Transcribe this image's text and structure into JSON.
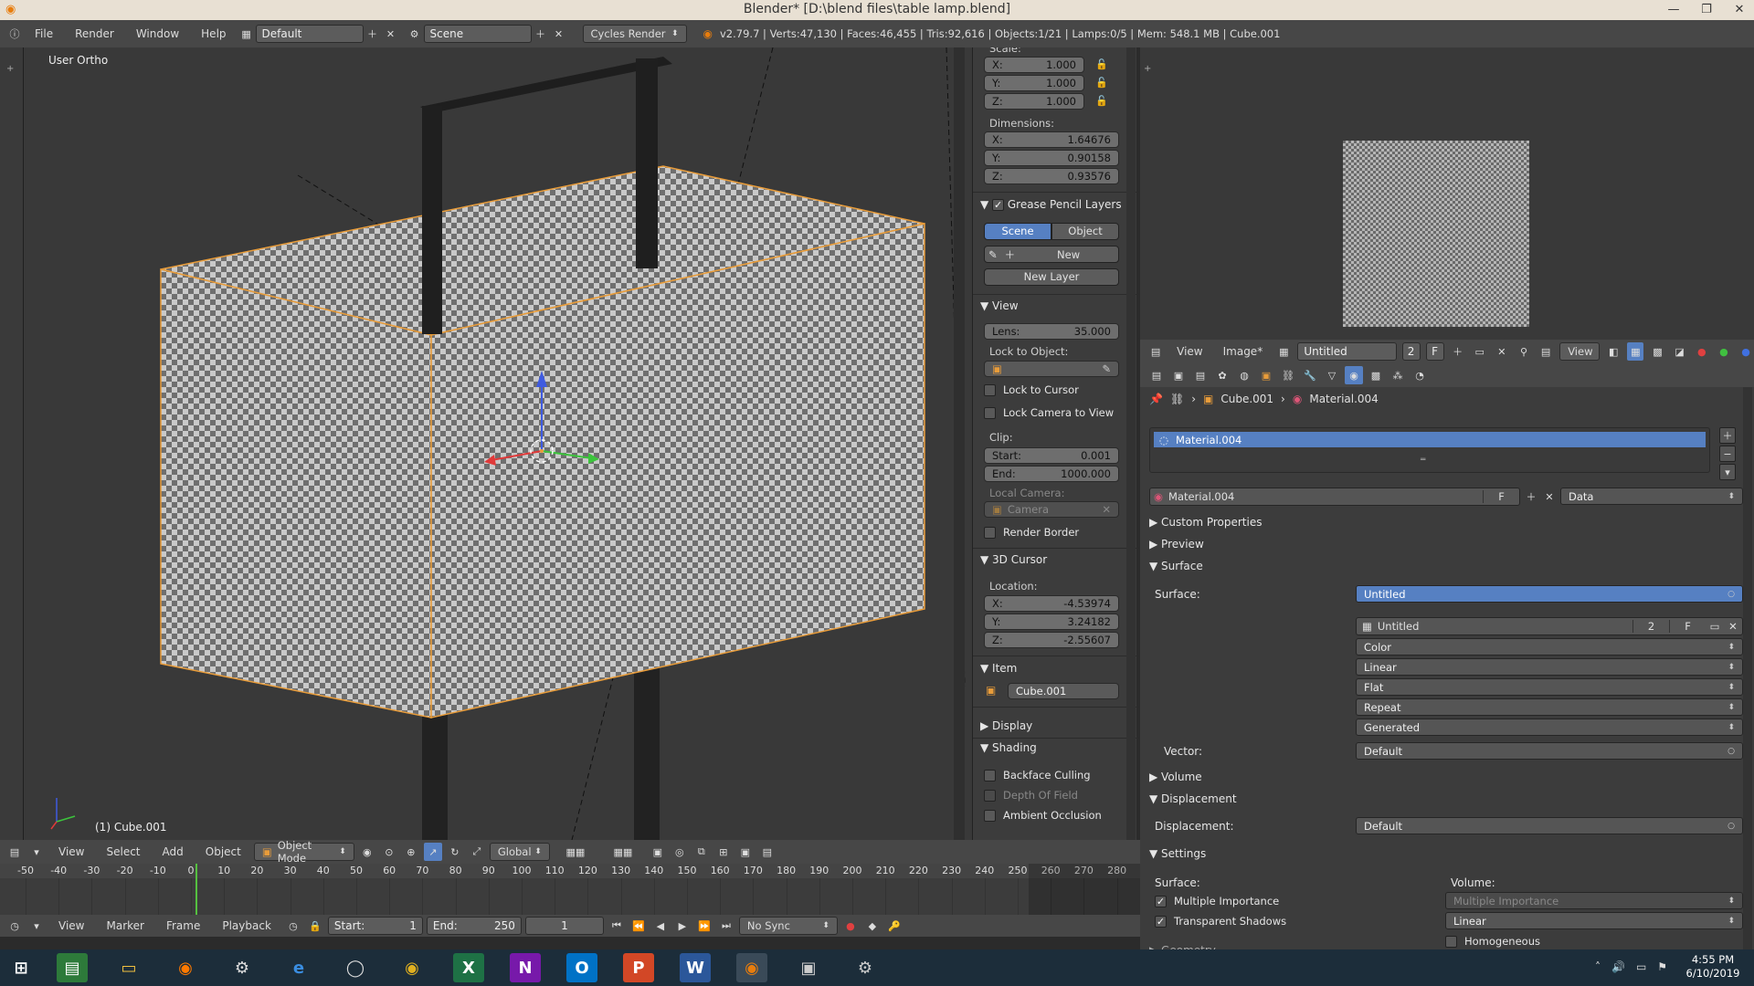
{
  "window": {
    "title": "Blender* [D:\\blend files\\table lamp.blend]"
  },
  "menus": [
    "File",
    "Render",
    "Window",
    "Help"
  ],
  "infobar": {
    "layout": "Default",
    "scene": "Scene",
    "engine": "Cycles Render",
    "stats": "v2.79.7 | Verts:47,130 | Faces:46,455 | Tris:92,616 | Objects:1/21 | Lamps:0/5 | Mem: 548.1 MB | Cube.001"
  },
  "viewport": {
    "view_label": "User Ortho",
    "object_label": "(1) Cube.001"
  },
  "npanel": {
    "scale_label": "Scale:",
    "scale": [
      {
        "k": "X:",
        "v": "1.000"
      },
      {
        "k": "Y:",
        "v": "1.000"
      },
      {
        "k": "Z:",
        "v": "1.000"
      }
    ],
    "dimensions_label": "Dimensions:",
    "dimensions": [
      {
        "k": "X:",
        "v": "1.64676"
      },
      {
        "k": "Y:",
        "v": "0.90158"
      },
      {
        "k": "Z:",
        "v": "0.93576"
      }
    ],
    "grease_pencil": "Grease Pencil Layers",
    "tab_scene": "Scene",
    "tab_object": "Object",
    "new_btn": "New",
    "new_layer": "New Layer",
    "view_header": "View",
    "lens_label": "Lens:",
    "lens_value": "35.000",
    "lock_to_object": "Lock to Object:",
    "lock_to_cursor": "Lock to Cursor",
    "lock_camera": "Lock Camera to View",
    "clip_label": "Clip:",
    "clip_start_k": "Start:",
    "clip_start_v": "0.001",
    "clip_end_k": "End:",
    "clip_end_v": "1000.000",
    "local_camera": "Local Camera:",
    "camera": "Camera",
    "render_border": "Render Border",
    "cursor_header": "3D Cursor",
    "location_label": "Location:",
    "location": [
      {
        "k": "X:",
        "v": "-4.53974"
      },
      {
        "k": "Y:",
        "v": "3.24182"
      },
      {
        "k": "Z:",
        "v": "-2.55607"
      }
    ],
    "item_header": "Item",
    "item_name": "Cube.001",
    "display_header": "Display",
    "shading_header": "Shading",
    "backface": "Backface Culling",
    "dof": "Depth Of Field",
    "ao": "Ambient Occlusion"
  },
  "image_editor": {
    "menus": [
      "View",
      "Image*"
    ],
    "image_name": "Untitled",
    "users": "2",
    "fake": "F",
    "view_btn": "View"
  },
  "properties": {
    "breadcrumb_object": "Cube.001",
    "breadcrumb_material": "Material.004",
    "slot": "Material.004",
    "material_name": "Material.004",
    "fake": "F",
    "link": "Data",
    "custom_props": "Custom Properties",
    "preview": "Preview",
    "surface_header": "Surface",
    "surface_label": "Surface:",
    "surface_value": "Untitled",
    "img_name": "Untitled",
    "img_users": "2",
    "img_fake": "F",
    "color": "Color",
    "linear": "Linear",
    "flat": "Flat",
    "repeat": "Repeat",
    "generated": "Generated",
    "vector_label": "Vector:",
    "vector_value": "Default",
    "volume": "Volume",
    "displacement_header": "Displacement",
    "displacement_label": "Displacement:",
    "displacement_value": "Default",
    "settings_header": "Settings",
    "settings_surface": "Surface:",
    "settings_volume": "Volume:",
    "multiple_importance": "Multiple Importance",
    "multiple_importance_vol": "Multiple Importance",
    "transparent_shadows": "Transparent Shadows",
    "vol_interp": "Linear",
    "homogeneous": "Homogeneous",
    "geometry": "Geometry"
  },
  "v3d_header": {
    "menus": [
      "View",
      "Select",
      "Add",
      "Object"
    ],
    "mode": "Object Mode",
    "orientation": "Global"
  },
  "timeline": {
    "ticks": [
      "-50",
      "-40",
      "-30",
      "-20",
      "-10",
      "0",
      "10",
      "20",
      "30",
      "40",
      "50",
      "60",
      "70",
      "80",
      "90",
      "100",
      "110",
      "120",
      "130",
      "140",
      "150",
      "160",
      "170",
      "180",
      "190",
      "200",
      "210",
      "220",
      "230",
      "240",
      "250",
      "260",
      "270",
      "280"
    ],
    "menus": [
      "View",
      "Marker",
      "Frame",
      "Playback"
    ],
    "start_k": "Start:",
    "start_v": "1",
    "end_k": "End:",
    "end_v": "250",
    "current": "1",
    "sync": "No Sync"
  },
  "taskbar": {
    "time": "4:55 PM",
    "date": "6/10/2019",
    "apps": [
      "start-icon",
      "store-icon",
      "file-explorer-icon",
      "firefox-icon",
      "steam-icon",
      "edge-icon",
      "cortana-icon",
      "chrome-icon",
      "excel-icon",
      "onenote-icon",
      "outlook-icon",
      "powerpoint-icon",
      "word-icon",
      "blender-icon",
      "window-icon",
      "settings-icon"
    ]
  }
}
